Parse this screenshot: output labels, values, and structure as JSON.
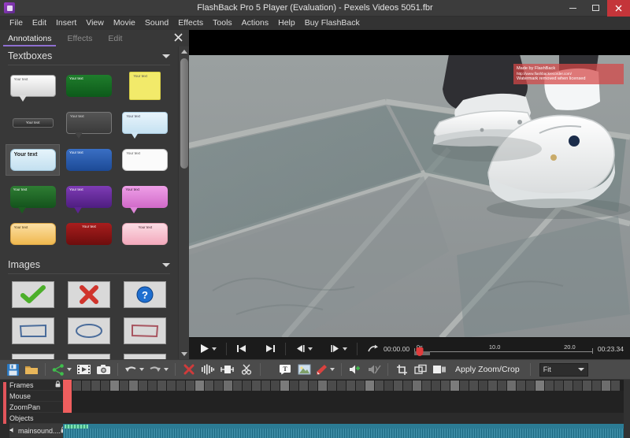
{
  "window": {
    "title": "FlashBack Pro 5 Player (Evaluation) - Pexels Videos 5051.fbr",
    "logo_name": "flashback-logo",
    "minimize": "–",
    "maximize": "▭",
    "close": "✕"
  },
  "menubar": {
    "items": [
      "File",
      "Edit",
      "Insert",
      "View",
      "Movie",
      "Sound",
      "Effects",
      "Tools",
      "Actions",
      "Help",
      "Buy FlashBack"
    ]
  },
  "sidebar": {
    "tabs": [
      {
        "label": "Annotations",
        "active": true
      },
      {
        "label": "Effects",
        "active": false
      },
      {
        "label": "Edit",
        "active": false
      }
    ],
    "close_label": "✕",
    "sections": [
      {
        "title": "Textboxes",
        "expanded": true
      },
      {
        "title": "Images",
        "expanded": true
      }
    ],
    "textbox_label": "Your text",
    "textboxes": [
      {
        "name": "textbox-white-callout",
        "style": "callout-light",
        "selected": false
      },
      {
        "name": "textbox-green-rounded",
        "style": "green-flat",
        "selected": false
      },
      {
        "name": "textbox-yellow-note",
        "style": "yellow-note",
        "selected": false
      },
      {
        "name": "textbox-dark-pill",
        "style": "dark-pill",
        "selected": false
      },
      {
        "name": "textbox-gray-callout",
        "style": "gray-callout",
        "selected": false
      },
      {
        "name": "textbox-paleblue-callout",
        "style": "paleblue-callout",
        "selected": false
      },
      {
        "name": "textbox-lightblue-rounded",
        "style": "lightblue-rounded",
        "selected": true
      },
      {
        "name": "textbox-blue-rounded",
        "style": "blue-rounded",
        "selected": false
      },
      {
        "name": "textbox-white-rounded",
        "style": "white-rounded",
        "selected": false
      },
      {
        "name": "textbox-darkgreen-callout",
        "style": "darkgreen-callout",
        "selected": false
      },
      {
        "name": "textbox-purple-callout",
        "style": "purple-callout",
        "selected": false
      },
      {
        "name": "textbox-pink-callout",
        "style": "pink-callout",
        "selected": false
      },
      {
        "name": "textbox-orange-rounded",
        "style": "orange-rounded",
        "selected": false
      },
      {
        "name": "textbox-red-rounded",
        "style": "red-rounded",
        "selected": false
      },
      {
        "name": "textbox-pinklight-rounded",
        "style": "pinklight-rounded",
        "selected": false
      }
    ],
    "images": [
      {
        "name": "image-green-check",
        "shape": "check",
        "color": "#4caf2a"
      },
      {
        "name": "image-red-cross",
        "shape": "cross",
        "color": "#d0342c"
      },
      {
        "name": "image-blue-question",
        "shape": "question",
        "color": "#1f6fd0"
      },
      {
        "name": "image-blue-rectangle",
        "shape": "rect",
        "color": "#4a6c9b"
      },
      {
        "name": "image-blue-ellipse",
        "shape": "ellipse",
        "color": "#4a6c9b"
      },
      {
        "name": "image-red-rectangle",
        "shape": "rect",
        "color": "#a85560"
      },
      {
        "name": "image-red-ellipse",
        "shape": "ellipse",
        "color": "#a85560"
      },
      {
        "name": "image-red-ellipse-2",
        "shape": "ellipse",
        "color": "#a85560"
      },
      {
        "name": "image-red-rectangle-2",
        "shape": "rect",
        "color": "#b04040"
      }
    ]
  },
  "player": {
    "watermark": {
      "line1": "Made by FlashBack",
      "line2": "http://www.flashbackrecorder.com/",
      "line3": "Watermark removed when licensed"
    },
    "controls": [
      {
        "name": "play-button",
        "glyph": "▶",
        "has_caret": true
      },
      {
        "name": "go-to-start-button",
        "glyph": "|◀",
        "has_caret": false
      },
      {
        "name": "go-to-end-button",
        "glyph": "▶|",
        "has_caret": false
      },
      {
        "name": "step-back-button",
        "glyph": "◀|",
        "has_caret": true
      },
      {
        "name": "step-forward-button",
        "glyph": "|▶",
        "has_caret": true
      },
      {
        "name": "loop-button",
        "glyph": "↷",
        "has_caret": false
      }
    ],
    "current_time": "00:00.00",
    "total_time": "00:23.34",
    "timeline_ticks": [
      "0s",
      "10.0",
      "20.0"
    ],
    "playhead_position_pct": 2
  },
  "toolbar": {
    "left_buttons": [
      {
        "name": "save-button",
        "icon": "floppy-disk-icon"
      },
      {
        "name": "open-button",
        "icon": "folder-icon"
      },
      {
        "name": "share-button",
        "icon": "share-icon",
        "has_caret": true
      },
      {
        "name": "export-movie-button",
        "icon": "film-icon"
      },
      {
        "name": "snapshot-button",
        "icon": "camera-icon"
      },
      {
        "name": "undo-button",
        "icon": "undo-arrow-icon",
        "has_caret": true
      },
      {
        "name": "redo-button",
        "icon": "redo-arrow-icon",
        "has_caret": true
      },
      {
        "name": "delete-button",
        "icon": "red-x-icon"
      },
      {
        "name": "trim-button",
        "icon": "waveform-icon"
      },
      {
        "name": "split-button",
        "icon": "split-icon"
      },
      {
        "name": "cut-button",
        "icon": "scissors-icon"
      }
    ],
    "right_buttons": [
      {
        "name": "add-textbox-button",
        "icon": "text-box-icon"
      },
      {
        "name": "add-image-button",
        "icon": "picture-icon"
      },
      {
        "name": "highlighter-button",
        "icon": "pen-icon",
        "has_caret": true
      },
      {
        "name": "add-sound-button",
        "icon": "speaker-plus-icon"
      },
      {
        "name": "mute-sound-button",
        "icon": "speaker-mute-icon"
      },
      {
        "name": "crop-button",
        "icon": "crop-icon"
      },
      {
        "name": "zoom-pan-button",
        "icon": "layers-icon"
      },
      {
        "name": "blur-button",
        "icon": "panel-icon"
      }
    ],
    "apply_label": "Apply Zoom/Crop",
    "zoom_select_value": "Fit"
  },
  "timeline": {
    "tracks": [
      {
        "name": "track-frames",
        "label": "Frames",
        "locked": true
      },
      {
        "name": "track-mouse",
        "label": "Mouse",
        "locked": false
      },
      {
        "name": "track-zoompan",
        "label": "ZoomPan",
        "locked": false
      },
      {
        "name": "track-objects",
        "label": "Objects",
        "locked": false
      }
    ],
    "audio_track": {
      "name": "track-mainsound",
      "label": "mainsound....",
      "locked": true
    },
    "lock_glyph": "🔒",
    "speaker_glyph": "◀"
  },
  "colors": {
    "accent_purple": "#8f6fd0",
    "close_red": "#c4353a",
    "watermark_red": "#d64646",
    "audio_teal": "#2b7b94",
    "marker_red": "#ef5e5e"
  }
}
